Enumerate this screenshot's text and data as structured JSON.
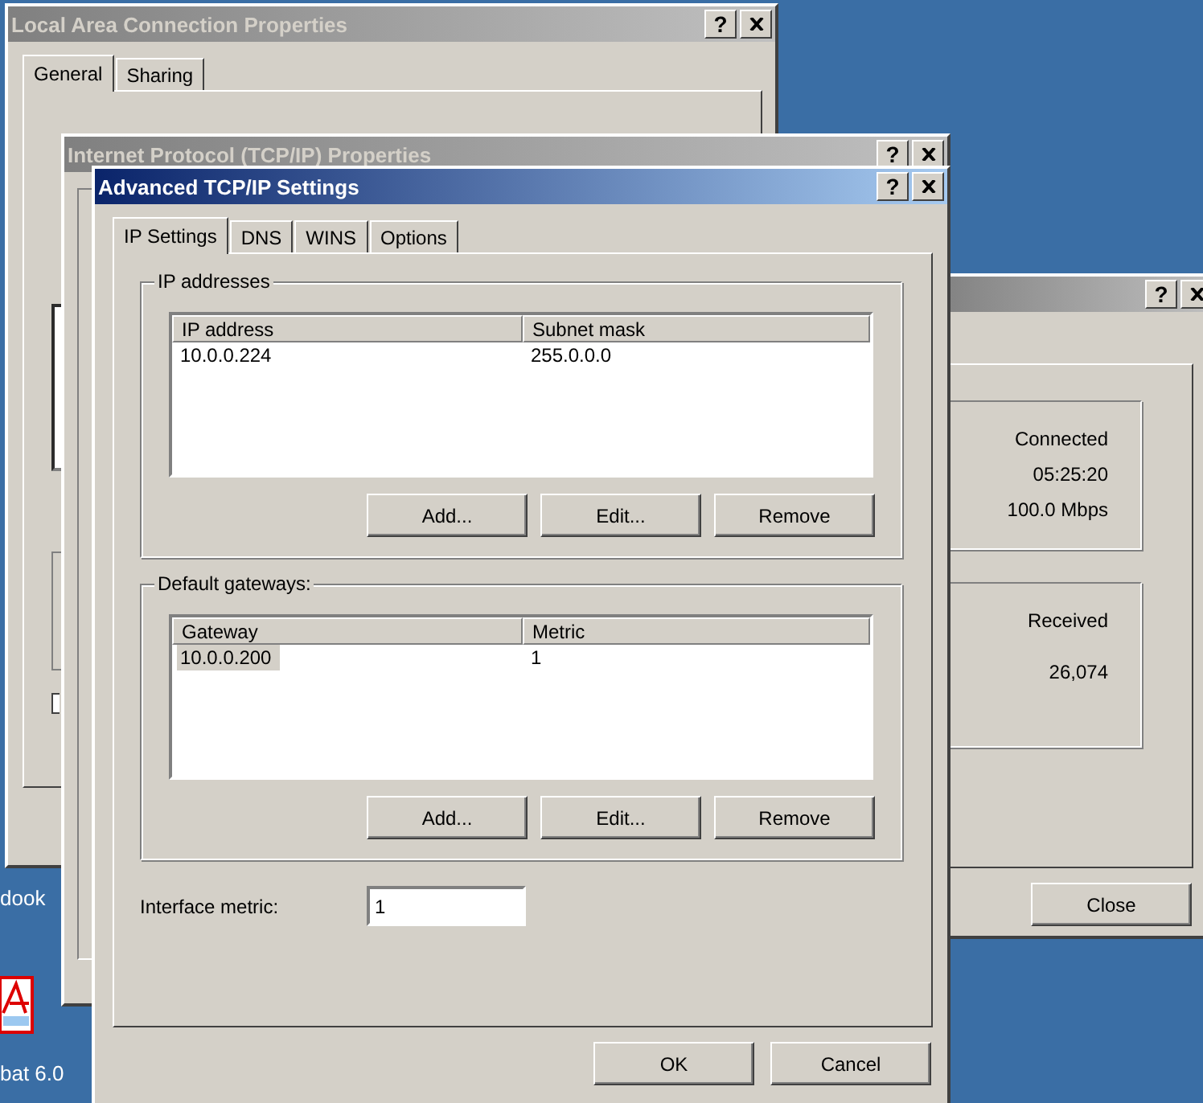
{
  "desktop": {
    "icons": [
      {
        "label": "dook"
      },
      {
        "label": "bat 6.0",
        "kind": "pdf"
      }
    ]
  },
  "status_window": {
    "active": false,
    "help": "?",
    "details": [
      "Connected",
      "05:25:20",
      "100.0 Mbps"
    ],
    "activity": {
      "heading": "Received",
      "value": "26,074"
    },
    "close_button": "Close"
  },
  "connection_window": {
    "title": "Local Area Connection Properties",
    "active": false,
    "help": "?",
    "tabs": [
      {
        "label": "General",
        "selected": true
      },
      {
        "label": "Sharing",
        "selected": false
      }
    ],
    "checkbox": {
      "checked": false
    }
  },
  "tcpip_window": {
    "title": "Internet Protocol (TCP/IP) Properties",
    "active": false,
    "help": "?"
  },
  "advanced_window": {
    "title": "Advanced TCP/IP Settings",
    "active": true,
    "help": "?",
    "tabs": [
      {
        "label": "IP Settings",
        "selected": true
      },
      {
        "label": "DNS",
        "selected": false
      },
      {
        "label": "WINS",
        "selected": false
      },
      {
        "label": "Options",
        "selected": false
      }
    ],
    "groups": [
      {
        "label": "IP addresses",
        "columns": [
          "IP address",
          "Subnet mask"
        ],
        "rows": [
          {
            "cells": [
              "10.0.0.224",
              "255.0.0.0"
            ],
            "selected": false
          }
        ],
        "buttons": [
          "Add...",
          "Edit...",
          "Remove"
        ]
      },
      {
        "label": "Default gateways:",
        "columns": [
          "Gateway",
          "Metric"
        ],
        "rows": [
          {
            "cells": [
              "10.0.0.200",
              "1"
            ],
            "selected": true
          }
        ],
        "buttons": [
          "Add...",
          "Edit...",
          "Remove"
        ]
      }
    ],
    "interface_metric": {
      "label": "Interface metric:",
      "value": "1"
    },
    "buttons": [
      "OK",
      "Cancel"
    ]
  }
}
